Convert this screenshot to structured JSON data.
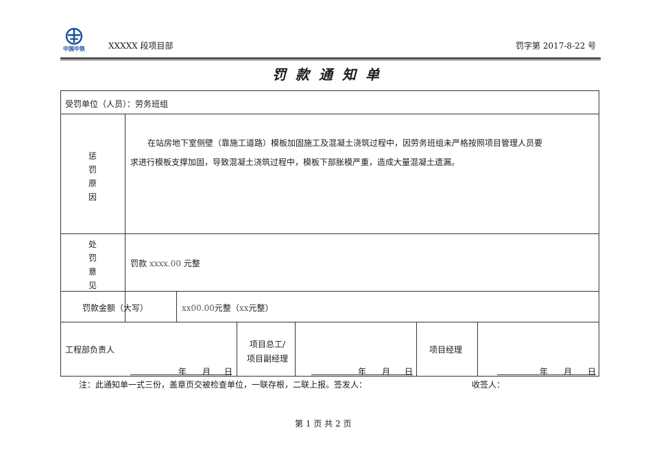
{
  "header": {
    "logo_text": "中国中铁",
    "project_dept": "XXXXX 段项目部",
    "doc_no": "罚字第 2017-8-22 号"
  },
  "title": "罚款通知单",
  "form": {
    "unit_label": "受罚单位（人员）：劳务班组",
    "reason_label": [
      "惩",
      "罚",
      "原",
      "因"
    ],
    "reason_text_line1": "在站房地下室侧壁（靠施工道路）模板加固施工及混凝土浇筑过程中，因劳务班组未严格按照项目管理人员要",
    "reason_text_line2": "求进行模板支撑加固，导致混凝土浇筑过程中，模板下部胀模严重，造成大量混凝土遗漏。",
    "opinion_label": [
      "处",
      "罚",
      "意",
      "见"
    ],
    "opinion_prefix": "罚款",
    "opinion_amount": "xxxx.00",
    "opinion_suffix": "元整",
    "amount_label": "罚款金额（大写）",
    "amount_value_num": "xx00.00",
    "amount_value_mid": "元整（",
    "amount_value_xx": "xx",
    "amount_value_end": "元整）",
    "sig1_label": "工程部负责人",
    "sig2_label_line1": "项目总工/",
    "sig2_label_line2": "项目副经理",
    "sig3_label": "项目经理",
    "date_year": "年",
    "date_month": "月",
    "date_day": "日"
  },
  "footnote": {
    "note": "注：此通知单一式三份，盖章页交被检查单位，一联存根，二联上报。签发人：",
    "receiver": "收签人："
  },
  "footer": {
    "page_prefix": "第",
    "page_current": "1",
    "page_mid": "页  共",
    "page_total": "2",
    "page_suffix": "页"
  }
}
